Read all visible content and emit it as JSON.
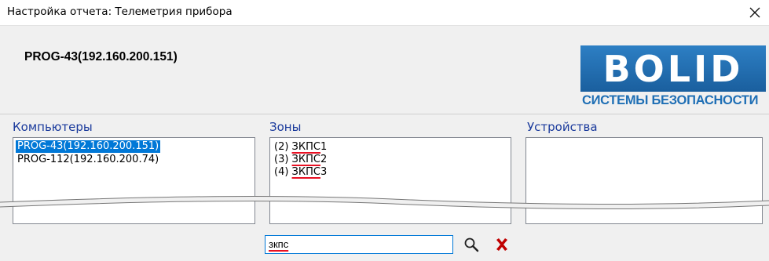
{
  "window": {
    "title": "Настройка отчета: Телеметрия прибора",
    "close_glyph": "✕"
  },
  "header": {
    "device_title": "PROG-43(192.160.200.151)",
    "logo": {
      "text": "BOLID",
      "caption": "СИСТЕМЫ БЕЗОПАСНОСТИ",
      "color": "#1f6fb5"
    }
  },
  "computers": {
    "label": "Компьютеры",
    "items": [
      {
        "text": "PROG-43(192.160.200.151)",
        "selected": true
      },
      {
        "text": "PROG-112(192.160.200.74)",
        "selected": false
      }
    ]
  },
  "zones": {
    "label": "Зоны",
    "items": [
      {
        "prefix": "(2) ",
        "match": "ЗКПС",
        "suffix": "1"
      },
      {
        "prefix": "(3) ",
        "match": "ЗКПС",
        "suffix": "2"
      },
      {
        "prefix": "(4) ",
        "match": "ЗКПС",
        "suffix": "3"
      }
    ]
  },
  "devices": {
    "label": "Устройства",
    "items": []
  },
  "search": {
    "value": "зкпс",
    "search_icon": "search-icon",
    "clear_icon": "clear-icon",
    "clear_color": "#c00000"
  }
}
